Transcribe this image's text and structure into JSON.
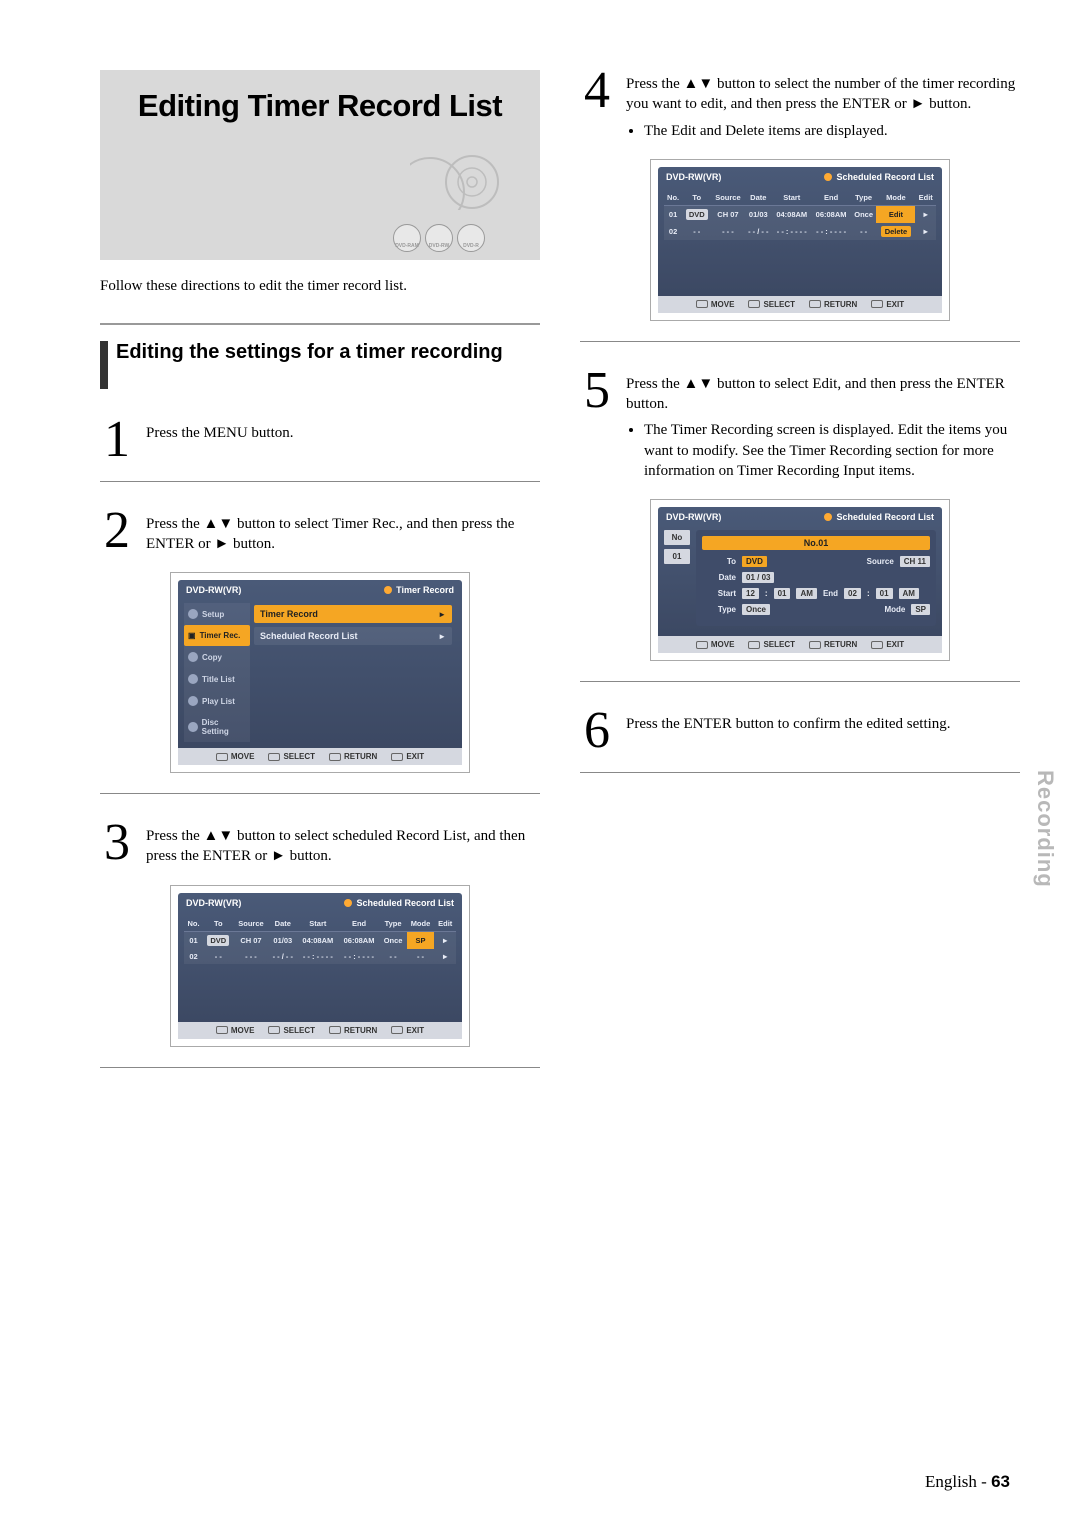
{
  "title": "Editing Timer Record List",
  "media_icons": [
    "DVD-RAM",
    "DVD-RW",
    "DVD-R"
  ],
  "intro": "Follow these directions to edit the timer record list.",
  "section_heading": "Editing the settings for a timer recording",
  "side_tab": "Recording",
  "footer": {
    "lang": "English -",
    "page": "63"
  },
  "steps": {
    "1": {
      "text": "Press the MENU button."
    },
    "2": {
      "pre": "Press the ",
      "mid": " button to select Timer Rec., and then press the ENTER or ",
      "post": " button."
    },
    "3": {
      "pre": "Press the ",
      "mid": " button to select scheduled Record List, and then press the ENTER or ",
      "post": " button."
    },
    "4": {
      "pre": "Press the ",
      "mid": " button to select the number of the timer recording you want to edit, and then press the ENTER or ",
      "post": " button.",
      "bullet": "The Edit and Delete items are displayed."
    },
    "5": {
      "pre": "Press the ",
      "mid": " button to select Edit, and then press the ENTER button.",
      "bullet": "The Timer Recording screen is displayed. Edit the items you want to modify. See the Timer Recording section for more information on Timer Recording Input items."
    },
    "6": {
      "text": "Press the ENTER button to confirm the edited setting."
    }
  },
  "osd": {
    "disc_label": "DVD-RW(VR)",
    "footer_keys": {
      "move": "MOVE",
      "select": "SELECT",
      "return": "RETURN",
      "exit": "EXIT"
    },
    "menu": {
      "title": "Timer Record",
      "items": [
        "Setup",
        "Timer Rec.",
        "Copy",
        "Title List",
        "Play List",
        "Disc Setting"
      ],
      "active_index": 1,
      "options": [
        {
          "label": "Timer Record",
          "active": true
        },
        {
          "label": "Scheduled Record List",
          "active": false
        }
      ]
    },
    "sched": {
      "title": "Scheduled Record List",
      "columns": [
        "No.",
        "To",
        "Source",
        "Date",
        "Start",
        "End",
        "Type",
        "Mode",
        "Edit"
      ],
      "rows": [
        {
          "no": "01",
          "to": "DVD",
          "source": "CH 07",
          "date": "01/03",
          "start": "04:08AM",
          "end": "06:08AM",
          "type": "Once",
          "mode": "SP",
          "edit": "►",
          "highlight": "mode"
        },
        {
          "no": "02",
          "to": "- -",
          "source": "- - -",
          "date": "- - / - -",
          "start": "- - : - - - -",
          "end": "- - : - - - -",
          "type": "- -",
          "mode": "- -",
          "edit": "►"
        }
      ]
    },
    "sched_edit": {
      "title": "Scheduled Record List",
      "columns": [
        "No.",
        "To",
        "Source",
        "Date",
        "Start",
        "End",
        "Type",
        "Mode",
        "Edit"
      ],
      "rows": [
        {
          "no": "01",
          "to": "DVD",
          "source": "CH 07",
          "date": "01/03",
          "start": "04:08AM",
          "end": "06:08AM",
          "type": "Once",
          "mode": "Edit",
          "edit": "►",
          "highlight": "mode"
        },
        {
          "no": "02",
          "to": "- -",
          "source": "- - -",
          "date": "- - / - -",
          "start": "- - : - - - -",
          "end": "- - : - - - -",
          "type": "- -",
          "mode": "Delete",
          "edit": "►",
          "mode_hl": true
        }
      ]
    },
    "editform": {
      "title": "Scheduled Record List",
      "sidebar": [
        "No",
        "01"
      ],
      "panel_title": "No.01",
      "to_label": "To",
      "to_val": "DVD",
      "source_label": "Source",
      "source_val": "CH 11",
      "date_label": "Date",
      "date_val": "01 / 03",
      "start_label": "Start",
      "start_h": "12",
      "start_m": "01",
      "start_ap": "AM",
      "end_label": "End",
      "end_h": "02",
      "end_m": "01",
      "end_ap": "AM",
      "type_label": "Type",
      "type_val": "Once",
      "mode_label": "Mode",
      "mode_val": "SP"
    }
  }
}
